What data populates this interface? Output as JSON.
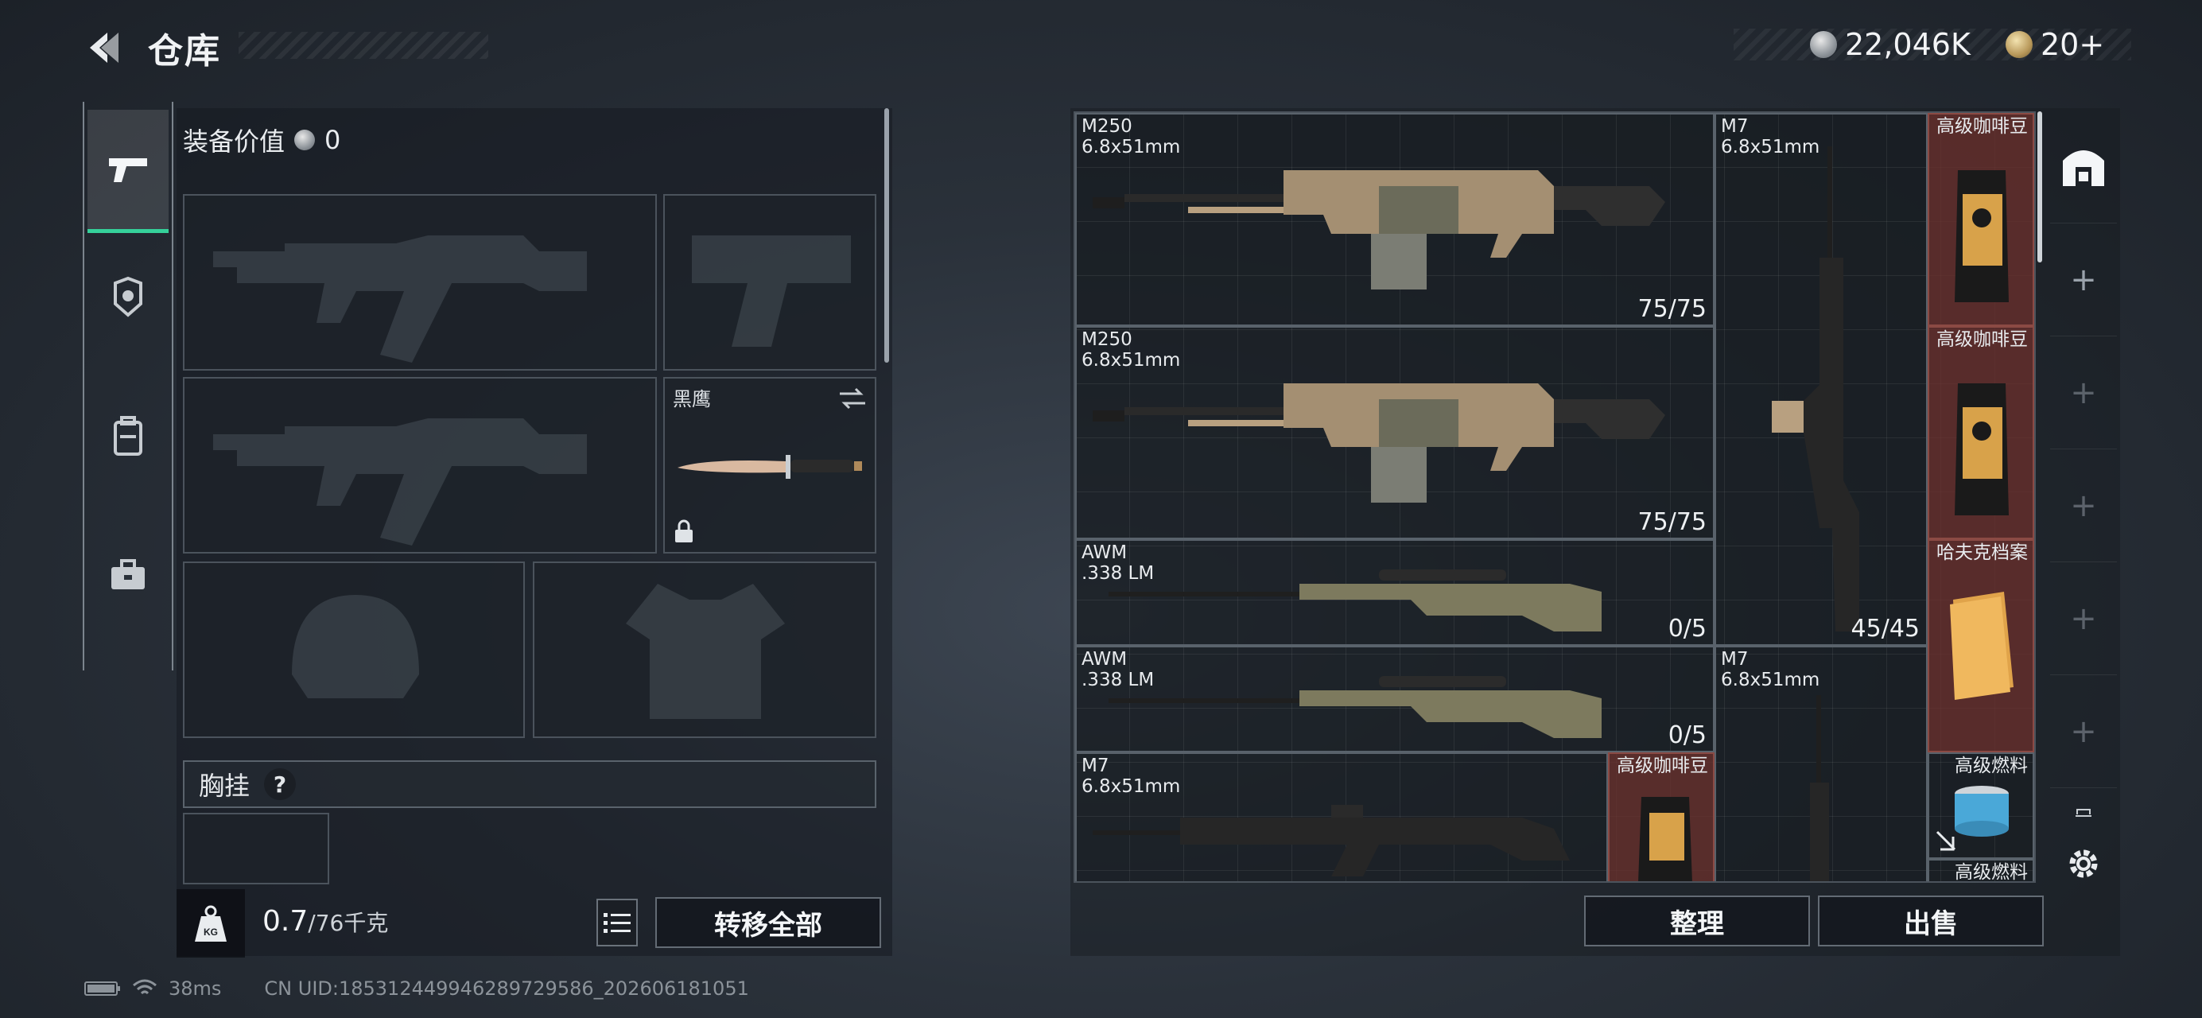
{
  "header": {
    "title": "仓库",
    "currency_silver": "22,046K",
    "currency_gold": "20+"
  },
  "loadout": {
    "equip_value_label": "装备价值",
    "equip_value": "0",
    "melee_label": "黑鹰",
    "chest_label": "胸挂",
    "chest_help": "?",
    "weight_current": "0.7",
    "weight_max": "/76千克",
    "transfer_all": "转移全部"
  },
  "warehouse": {
    "items": [
      {
        "name": "M250",
        "ammo": "6.8x51mm",
        "count": "75/75"
      },
      {
        "name": "M250",
        "ammo": "6.8x51mm",
        "count": "75/75"
      },
      {
        "name": "AWM",
        "ammo": ".338 LM",
        "count": "0/5"
      },
      {
        "name": "AWM",
        "ammo": ".338 LM",
        "count": "0/5"
      },
      {
        "name": "M7",
        "ammo": "6.8x51mm",
        "count": ""
      },
      {
        "name": "M7",
        "ammo": "6.8x51mm",
        "count": "45/45"
      },
      {
        "name": "M7",
        "ammo": "6.8x51mm",
        "count": ""
      }
    ],
    "misc": [
      {
        "name": "高级咖啡豆"
      },
      {
        "name": "高级咖啡豆"
      },
      {
        "name": "哈夫克档案"
      },
      {
        "name": "高级燃料"
      },
      {
        "name": "高级燃料"
      },
      {
        "name": "高级咖啡豆"
      }
    ],
    "organize": "整理",
    "sell": "出售"
  },
  "status": {
    "ping": "38ms",
    "uid": "CN UID:185312449946289729586_202606181051"
  },
  "colors": {
    "accent_green": "#35d19a",
    "rare_item_red": "#6e322d"
  }
}
